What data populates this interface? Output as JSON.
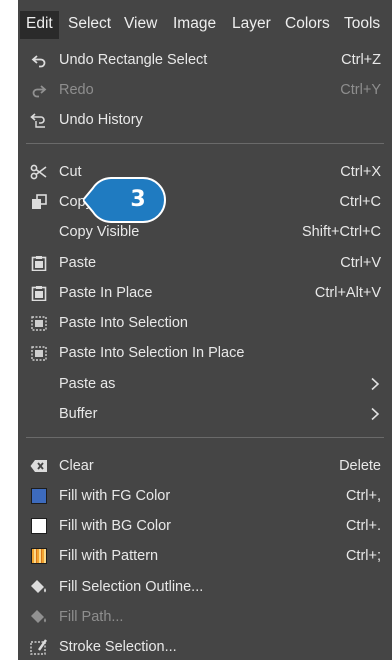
{
  "menubar": {
    "items": [
      "Edit",
      "Select",
      "View",
      "Image",
      "Layer",
      "Colors",
      "Tools"
    ],
    "active_index": 0
  },
  "edit_menu": {
    "undo": {
      "label": "Undo Rectangle Select",
      "shortcut": "Ctrl+Z",
      "icon": "undo-icon"
    },
    "redo": {
      "label": "Redo",
      "shortcut": "Ctrl+Y",
      "icon": "redo-icon",
      "enabled": false
    },
    "undo_history": {
      "label": "Undo History",
      "icon": "undo-history-icon"
    },
    "cut": {
      "label": "Cut",
      "shortcut": "Ctrl+X",
      "icon": "scissors-icon"
    },
    "copy": {
      "label": "Copy",
      "shortcut": "Ctrl+C",
      "icon": "copy-icon"
    },
    "copy_visible": {
      "label": "Copy Visible",
      "shortcut": "Shift+Ctrl+C"
    },
    "paste": {
      "label": "Paste",
      "shortcut": "Ctrl+V",
      "icon": "paste-icon"
    },
    "paste_in_place": {
      "label": "Paste In Place",
      "shortcut": "Ctrl+Alt+V",
      "icon": "paste-in-place-icon"
    },
    "paste_into_selection": {
      "label": "Paste Into Selection",
      "icon": "paste-into-selection-icon"
    },
    "paste_into_selection_in_place": {
      "label": "Paste Into Selection In Place",
      "icon": "paste-into-selection-in-place-icon"
    },
    "paste_as": {
      "label": "Paste as",
      "submenu": true
    },
    "buffer": {
      "label": "Buffer",
      "submenu": true
    },
    "clear": {
      "label": "Clear",
      "shortcut": "Delete",
      "icon": "clear-icon"
    },
    "fill_fg": {
      "label": "Fill with FG Color",
      "shortcut": "Ctrl+,",
      "icon": "fg-color-swatch-icon",
      "color": "#3d6bbd"
    },
    "fill_bg": {
      "label": "Fill with BG Color",
      "shortcut": "Ctrl+.",
      "icon": "bg-color-swatch-icon",
      "color": "#ffffff"
    },
    "fill_pattern": {
      "label": "Fill with Pattern",
      "shortcut": "Ctrl+;",
      "icon": "pattern-swatch-icon"
    },
    "fill_selection_outline": {
      "label": "Fill Selection Outline...",
      "icon": "bucket-fill-icon"
    },
    "fill_path": {
      "label": "Fill Path...",
      "icon": "bucket-fill-icon",
      "enabled": false
    },
    "stroke_selection": {
      "label": "Stroke Selection...",
      "icon": "stroke-icon"
    }
  },
  "callout": {
    "number": "3",
    "color": "#1f7bc1"
  }
}
